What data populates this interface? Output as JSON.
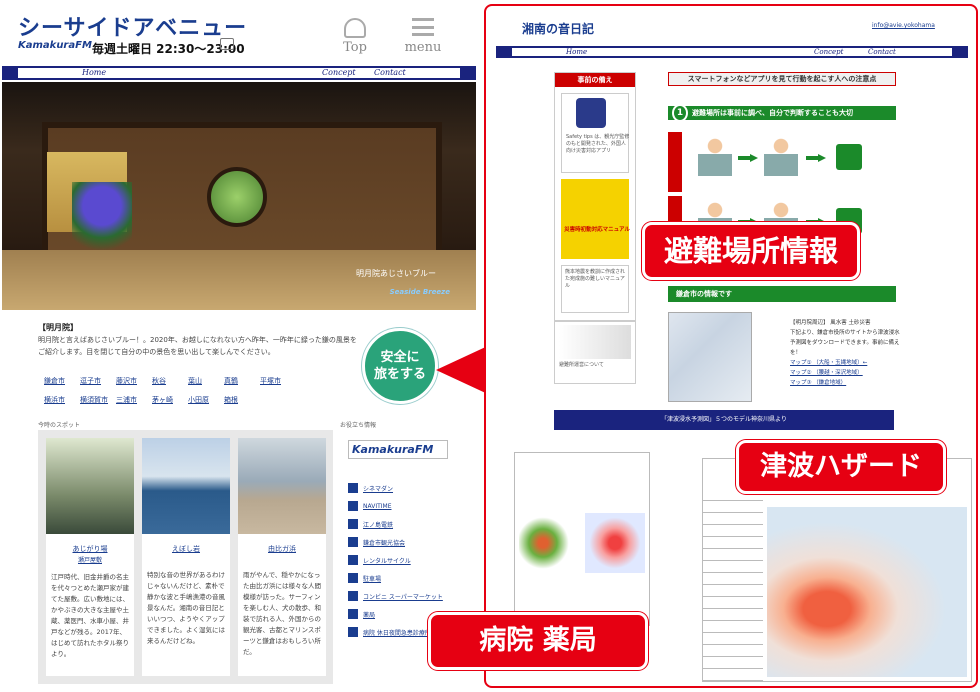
{
  "left": {
    "site_title": "シーサイドアベニュー",
    "station_logo": "KamakuraFM",
    "schedule": "毎週土曜日 22:30～23:00",
    "top_label": "Top",
    "menu_label": "menu",
    "nav": [
      "Home",
      "Concept",
      "Contact"
    ],
    "hero_caption": "明月院あじさいブルー",
    "hero_tag": "Seaside Breeze",
    "intro_title": "【明月院】",
    "intro_text": "明月院と言えばあじさいブルー！。2020年、お越しになれない方へ昨年、一昨年に録った鎌の風景をご紹介します。目を閉じて自分の中の景色を思い出して楽しんでください。",
    "areas": [
      "鎌倉市",
      "逗子市",
      "藤沢市",
      "秋谷",
      "葉山",
      "真鶴",
      "平塚市",
      "横浜市",
      "横須賀市",
      "三浦市",
      "茅ヶ崎",
      "小田原",
      "箱根"
    ],
    "safe_button": [
      "安全に",
      "旅をする"
    ],
    "spots_label": "今時のスポット",
    "info_label": "お役立ち情報",
    "cards": [
      {
        "title": "あじがり場",
        "sub": "瀬戸屋敷",
        "text": "江戸時代、旧金井爵の名主を代々つとめた瀬戸家が建てた屋敷。広い敷地には、かやぶきの大きな主屋や土蔵、薬医門、水車小屋、井戸などが残る。2017年、はじめて訪れたホタル祭りより。"
      },
      {
        "title": "えぼし岩",
        "sub": "",
        "text": "特別な音の世界があるわけじゃないんだけど、素朴で静かな波と手嶋漁港の音風景なんだ。湘南の音日記といいつつ、ようやくアップできました。よく湿気には来るんだけどね。"
      },
      {
        "title": "由比ガ浜",
        "sub": "",
        "text": "雨がやんで、穏やかになった由比ガ浜には様々な人間模様が訪った。サーフィンを楽しむ人、犬の散歩、和装で訪れる人、外国からの観光客、古都とマリンスポーツと鎌倉はおもしろい所だ。"
      }
    ],
    "links": [
      "シネマダン",
      "NAVITIME",
      "江ノ島電鉄",
      "鎌倉市観光協会",
      "レンタルサイクル",
      "駐車場",
      "コンビニ スーパーマーケット",
      "薬局",
      "病院 休日夜間急患診療所"
    ]
  },
  "right": {
    "title": "湘南の音日記",
    "mail": "info@avie.yokohama",
    "nav": [
      "Home",
      "Concept",
      "Contact"
    ],
    "prep_header": "事前の備え",
    "app_caption": "Safety tips は、観光庁監修のもと開発された、外国人向け災害対応アプリ",
    "manual_caption": "災害時初動対応マニュアル",
    "manual_note": "熊本地震を教訓に作成された宛成施の難しいマニュアル",
    "evac_note": "避難所運営について",
    "cautions_title": "スマートフォンなどアプリを見て行動を起こす人への注意点",
    "step_num": "1",
    "step_text": "避難場所は事前に調べ、自分で判断することも大切",
    "kamakura_bar": "鎌倉市の情報です",
    "kamakura_text": [
      "【明月院周辺】 風水害 土砂災害",
      "下記より、鎌倉市役所のサイトから津波浸水予測図をダウンロードできます。事前に備えを！",
      "マップ① （大船・玉縄地域）←",
      "マップ② （腰越・深沢地域）",
      "マップ③ （鎌倉地域）"
    ],
    "tsunami_bar": "「津波浸水予測図」５つのモデル神奈川県より"
  },
  "callouts": {
    "evacuation": "避難場所情報",
    "tsunami": "津波ハザード",
    "hospital": "病院 薬局"
  }
}
